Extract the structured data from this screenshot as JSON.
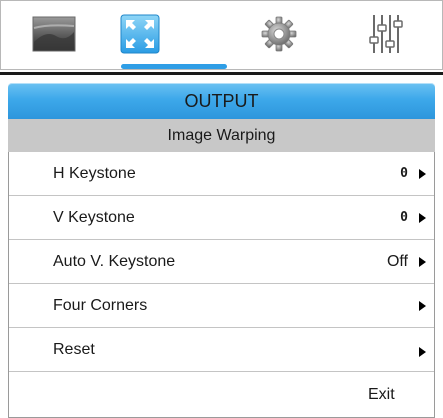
{
  "tabs": [
    {
      "id": "picture",
      "icon": "picture-icon",
      "active": false
    },
    {
      "id": "output",
      "icon": "expand-arrows-icon",
      "active": true
    },
    {
      "id": "setup",
      "icon": "gear-icon",
      "active": false
    },
    {
      "id": "audio",
      "icon": "equalizer-sliders-icon",
      "active": false
    }
  ],
  "header": {
    "title": "OUTPUT",
    "subtitle": "Image Warping"
  },
  "menu": {
    "items": [
      {
        "label": "H Keystone",
        "value": "0",
        "has_arrow": true
      },
      {
        "label": "V Keystone",
        "value": "0",
        "has_arrow": true
      },
      {
        "label": "Auto V. Keystone",
        "value": "Off",
        "has_arrow": true
      },
      {
        "label": "Four Corners",
        "value": "",
        "has_arrow": true
      },
      {
        "label": "Reset",
        "value": "",
        "has_arrow": true
      }
    ],
    "exit_label": "Exit"
  },
  "colors": {
    "accent": "#2f9ee6",
    "header_band": "#3da8ea",
    "subheader_band": "#c8c8c8"
  }
}
